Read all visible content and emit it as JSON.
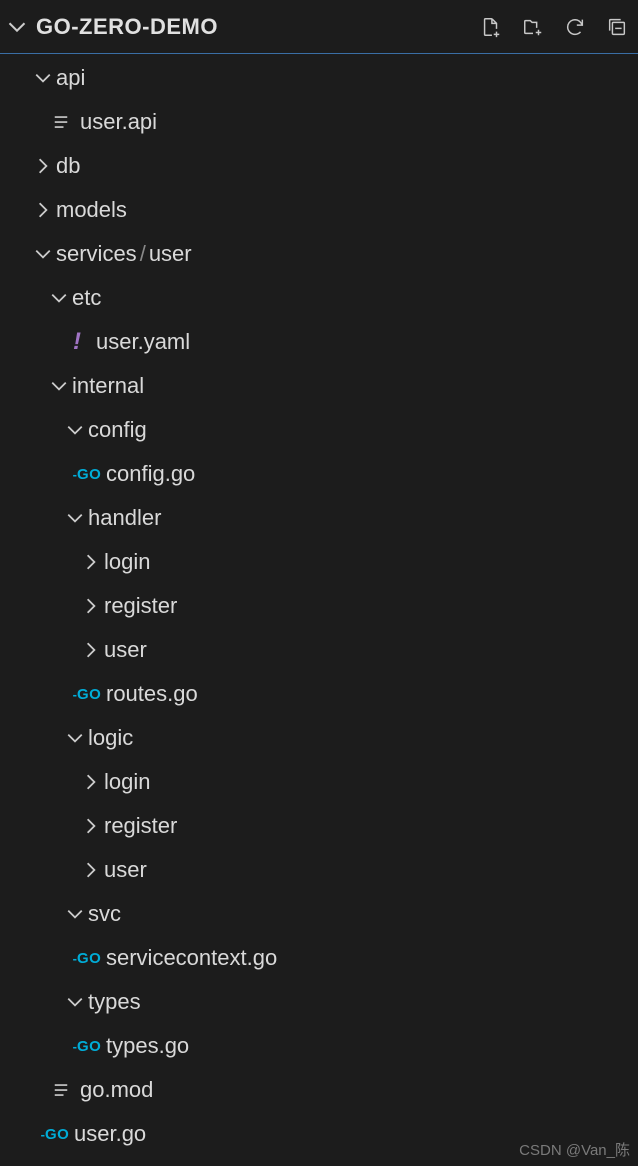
{
  "header": {
    "title": "GO-ZERO-DEMO"
  },
  "tree": {
    "api": {
      "label": "api"
    },
    "user_api": {
      "label": "user.api"
    },
    "db": {
      "label": "db"
    },
    "models": {
      "label": "models"
    },
    "services": {
      "label": "services"
    },
    "user_folder": {
      "label": "user"
    },
    "etc": {
      "label": "etc"
    },
    "user_yaml": {
      "label": "user.yaml"
    },
    "internal": {
      "label": "internal"
    },
    "config": {
      "label": "config"
    },
    "config_go": {
      "label": "config.go"
    },
    "handler": {
      "label": "handler"
    },
    "login": {
      "label": "login"
    },
    "register": {
      "label": "register"
    },
    "user_sub": {
      "label": "user"
    },
    "routes_go": {
      "label": "routes.go"
    },
    "logic": {
      "label": "logic"
    },
    "login2": {
      "label": "login"
    },
    "register2": {
      "label": "register"
    },
    "user_sub2": {
      "label": "user"
    },
    "svc": {
      "label": "svc"
    },
    "servicecontext_go": {
      "label": "servicecontext.go"
    },
    "types": {
      "label": "types"
    },
    "types_go": {
      "label": "types.go"
    },
    "go_mod": {
      "label": "go.mod"
    },
    "user_go": {
      "label": "user.go"
    }
  },
  "watermark": "CSDN @Van_陈"
}
